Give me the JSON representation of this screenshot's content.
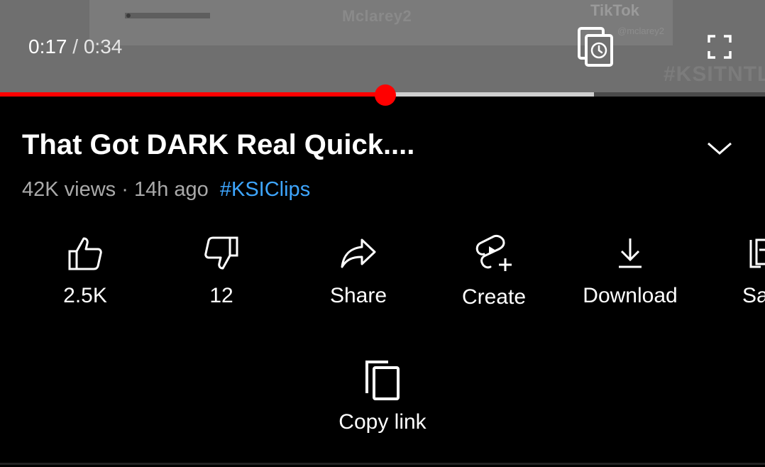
{
  "video": {
    "watermark_user": "Mclarey2",
    "watermark_brand": "TikTok",
    "watermark_handle": "@mclarey2",
    "watermark_hashtag": "#KSITNTL",
    "current_time": "0:17",
    "separator": "/",
    "duration": "0:34",
    "played_fraction": 0.504,
    "buffered_fraction": 0.776
  },
  "details": {
    "title": "That Got DARK Real Quick....",
    "views": "42K views",
    "dot": "·",
    "age": "14h ago",
    "hashtag": "#KSIClips"
  },
  "actions": [
    {
      "icon": "thumbs-up-icon",
      "label": "2.5K"
    },
    {
      "icon": "thumbs-down-icon",
      "label": "12"
    },
    {
      "icon": "share-icon",
      "label": "Share"
    },
    {
      "icon": "create-icon",
      "label": "Create"
    },
    {
      "icon": "download-icon",
      "label": "Download"
    },
    {
      "icon": "save-icon",
      "label": "Sa"
    },
    {
      "icon": "copy-icon",
      "label": "Copy link"
    }
  ],
  "colors": {
    "accent_red": "#ff0000",
    "hashtag_blue": "#3ea6ff",
    "meta_gray": "#aaaaaa",
    "background": "#000000"
  }
}
